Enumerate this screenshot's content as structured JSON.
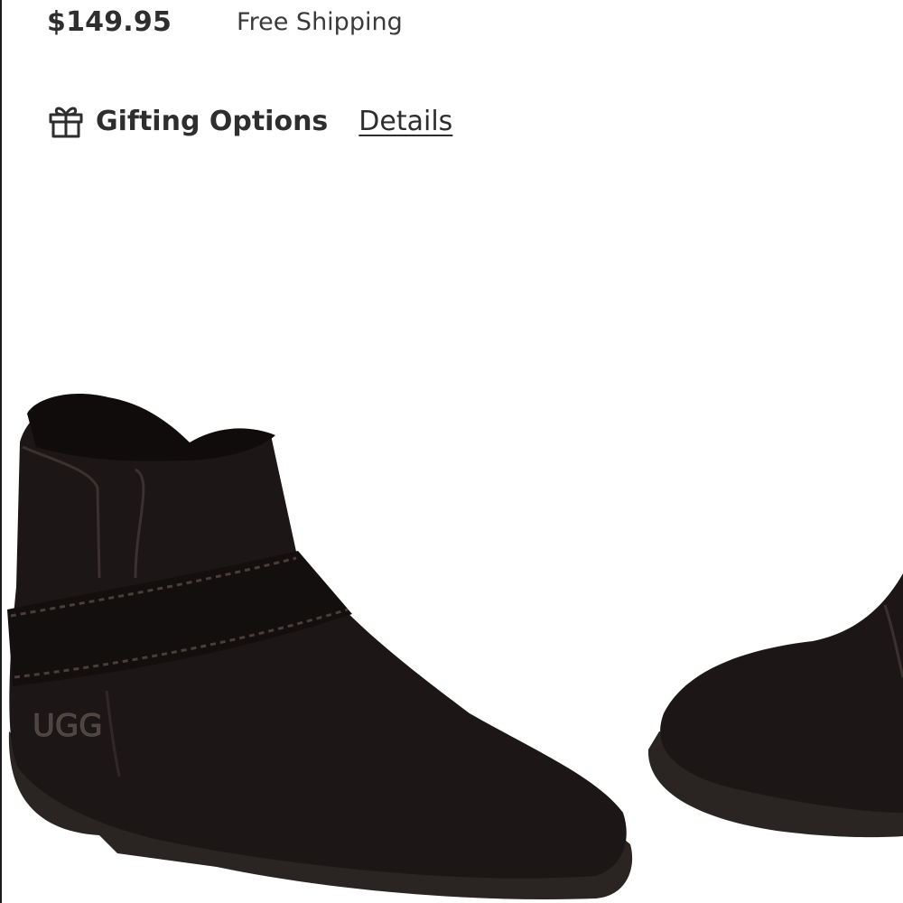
{
  "product": {
    "price": "$149.95",
    "shipping": "Free Shipping"
  },
  "gifting": {
    "icon": "gift-icon",
    "label": "Gifting Options",
    "details_link": "Details"
  },
  "image": {
    "subject": "boot-pair",
    "brand_mark": "UGG",
    "colors": {
      "boot": "#1c1716",
      "sole": "#2a2422",
      "background": "#ffffff"
    }
  }
}
